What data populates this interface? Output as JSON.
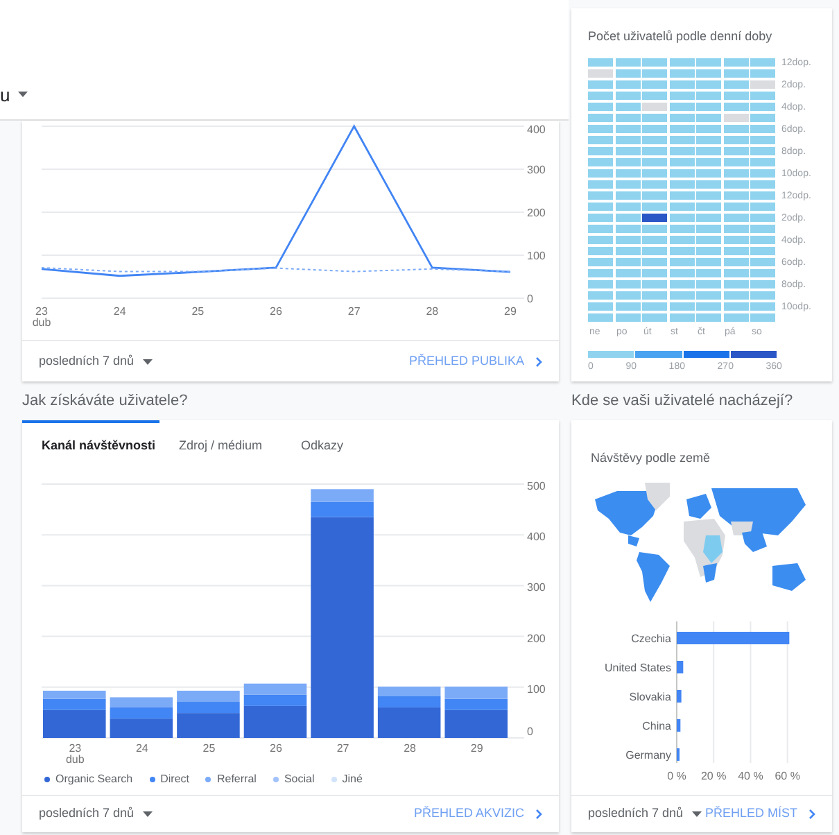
{
  "header": {
    "label": "u"
  },
  "audience_card": {
    "chart_data": {
      "type": "line",
      "grid": true,
      "categories": [
        "23",
        "24",
        "25",
        "26",
        "27",
        "28",
        "29"
      ],
      "ylim": [
        0,
        400
      ],
      "yticks": [
        0,
        100,
        200,
        300,
        400
      ],
      "series": [
        {
          "color": "#4285f4",
          "line_style": "solid",
          "values": [
            68,
            52,
            61,
            71,
            400,
            71,
            61
          ]
        },
        {
          "color": "#7baaf7",
          "line_style": "dashed",
          "values": [
            71,
            62,
            62,
            70,
            62,
            68,
            62
          ]
        }
      ]
    },
    "first_date_sublabel": "dub",
    "date_range": "posledních 7 dnů",
    "link": "PŘEHLED PUBLIKA"
  },
  "hourly_card": {
    "title": "Počet uživatelů podle denní doby",
    "rows": [
      {
        "label": "12dop.",
        "cells": [
          {
            "color": "#8fd3ef"
          },
          {
            "color": "#8fd3ef"
          },
          {
            "color": "#8fd3ef"
          },
          {
            "color": "#8fd3ef"
          },
          {
            "color": "#8fd3ef"
          },
          {
            "color": "#8fd3ef"
          },
          {
            "color": "#8fd3ef"
          }
        ]
      },
      {
        "cells": [
          {
            "color": "#dadce0"
          },
          {
            "color": "#8fd3ef"
          },
          {
            "color": "#8fd3ef"
          },
          {
            "color": "#8fd3ef"
          },
          {
            "color": "#8fd3ef"
          },
          {
            "color": "#8fd3ef"
          },
          {
            "color": "#8fd3ef"
          }
        ]
      },
      {
        "label": "2dop.",
        "cells": [
          {
            "color": "#8fd3ef"
          },
          {
            "color": "#8fd3ef"
          },
          {
            "color": "#8fd3ef"
          },
          {
            "color": "#8fd3ef"
          },
          {
            "color": "#8fd3ef"
          },
          {
            "color": "#8fd3ef"
          },
          {
            "color": "#dadce0"
          }
        ]
      },
      {
        "cells": [
          {
            "color": "#8fd3ef"
          },
          {
            "color": "#8fd3ef"
          },
          {
            "color": "#8fd3ef"
          },
          {
            "color": "#8fd3ef"
          },
          {
            "color": "#8fd3ef"
          },
          {
            "color": "#8fd3ef"
          },
          {
            "color": "#8fd3ef"
          }
        ]
      },
      {
        "label": "4dop.",
        "cells": [
          {
            "color": "#8fd3ef"
          },
          {
            "color": "#8fd3ef"
          },
          {
            "color": "#dadce0"
          },
          {
            "color": "#8fd3ef"
          },
          {
            "color": "#8fd3ef"
          },
          {
            "color": "#8fd3ef"
          },
          {
            "color": "#8fd3ef"
          }
        ]
      },
      {
        "cells": [
          {
            "color": "#8fd3ef"
          },
          {
            "color": "#8fd3ef"
          },
          {
            "color": "#8fd3ef"
          },
          {
            "color": "#8fd3ef"
          },
          {
            "color": "#8fd3ef"
          },
          {
            "color": "#dadce0"
          },
          {
            "color": "#8fd3ef"
          }
        ]
      },
      {
        "label": "6dop.",
        "cells": [
          {
            "color": "#8fd3ef"
          },
          {
            "color": "#8fd3ef"
          },
          {
            "color": "#8fd3ef"
          },
          {
            "color": "#8fd3ef"
          },
          {
            "color": "#8fd3ef"
          },
          {
            "color": "#8fd3ef"
          },
          {
            "color": "#8fd3ef"
          }
        ]
      },
      {
        "cells": [
          {
            "color": "#8fd3ef"
          },
          {
            "color": "#8fd3ef"
          },
          {
            "color": "#8fd3ef"
          },
          {
            "color": "#8fd3ef"
          },
          {
            "color": "#8fd3ef"
          },
          {
            "color": "#8fd3ef"
          },
          {
            "color": "#8fd3ef"
          }
        ]
      },
      {
        "label": "8dop.",
        "cells": [
          {
            "color": "#8fd3ef"
          },
          {
            "color": "#8fd3ef"
          },
          {
            "color": "#8fd3ef"
          },
          {
            "color": "#8fd3ef"
          },
          {
            "color": "#8fd3ef"
          },
          {
            "color": "#8fd3ef"
          },
          {
            "color": "#8fd3ef"
          }
        ]
      },
      {
        "cells": [
          {
            "color": "#8fd3ef"
          },
          {
            "color": "#8fd3ef"
          },
          {
            "color": "#8fd3ef"
          },
          {
            "color": "#8fd3ef"
          },
          {
            "color": "#8fd3ef"
          },
          {
            "color": "#8fd3ef"
          },
          {
            "color": "#8fd3ef"
          }
        ]
      },
      {
        "label": "10dop.",
        "cells": [
          {
            "color": "#8fd3ef"
          },
          {
            "color": "#8fd3ef"
          },
          {
            "color": "#8fd3ef"
          },
          {
            "color": "#8fd3ef"
          },
          {
            "color": "#8fd3ef"
          },
          {
            "color": "#8fd3ef"
          },
          {
            "color": "#8fd3ef"
          }
        ]
      },
      {
        "cells": [
          {
            "color": "#8fd3ef"
          },
          {
            "color": "#8fd3ef"
          },
          {
            "color": "#8fd3ef"
          },
          {
            "color": "#8fd3ef"
          },
          {
            "color": "#8fd3ef"
          },
          {
            "color": "#8fd3ef"
          },
          {
            "color": "#8fd3ef"
          }
        ]
      },
      {
        "label": "12odp.",
        "cells": [
          {
            "color": "#8fd3ef"
          },
          {
            "color": "#8fd3ef"
          },
          {
            "color": "#8fd3ef"
          },
          {
            "color": "#8fd3ef"
          },
          {
            "color": "#8fd3ef"
          },
          {
            "color": "#8fd3ef"
          },
          {
            "color": "#8fd3ef"
          }
        ]
      },
      {
        "cells": [
          {
            "color": "#8fd3ef"
          },
          {
            "color": "#8fd3ef"
          },
          {
            "color": "#8fd3ef"
          },
          {
            "color": "#8fd3ef"
          },
          {
            "color": "#8fd3ef"
          },
          {
            "color": "#8fd3ef"
          },
          {
            "color": "#8fd3ef"
          }
        ]
      },
      {
        "label": "2odp.",
        "cells": [
          {
            "color": "#8fd3ef"
          },
          {
            "color": "#8fd3ef"
          },
          {
            "color": "#2a56c6"
          },
          {
            "color": "#8fd3ef"
          },
          {
            "color": "#8fd3ef"
          },
          {
            "color": "#8fd3ef"
          },
          {
            "color": "#8fd3ef"
          }
        ]
      },
      {
        "cells": [
          {
            "color": "#8fd3ef"
          },
          {
            "color": "#8fd3ef"
          },
          {
            "color": "#8fd3ef"
          },
          {
            "color": "#8fd3ef"
          },
          {
            "color": "#8fd3ef"
          },
          {
            "color": "#8fd3ef"
          },
          {
            "color": "#8fd3ef"
          }
        ]
      },
      {
        "label": "4odp.",
        "cells": [
          {
            "color": "#8fd3ef"
          },
          {
            "color": "#8fd3ef"
          },
          {
            "color": "#8fd3ef"
          },
          {
            "color": "#8fd3ef"
          },
          {
            "color": "#8fd3ef"
          },
          {
            "color": "#8fd3ef"
          },
          {
            "color": "#8fd3ef"
          }
        ]
      },
      {
        "cells": [
          {
            "color": "#8fd3ef"
          },
          {
            "color": "#8fd3ef"
          },
          {
            "color": "#8fd3ef"
          },
          {
            "color": "#8fd3ef"
          },
          {
            "color": "#8fd3ef"
          },
          {
            "color": "#8fd3ef"
          },
          {
            "color": "#8fd3ef"
          }
        ]
      },
      {
        "label": "6odp.",
        "cells": [
          {
            "color": "#8fd3ef"
          },
          {
            "color": "#8fd3ef"
          },
          {
            "color": "#8fd3ef"
          },
          {
            "color": "#8fd3ef"
          },
          {
            "color": "#8fd3ef"
          },
          {
            "color": "#8fd3ef"
          },
          {
            "color": "#8fd3ef"
          }
        ]
      },
      {
        "cells": [
          {
            "color": "#8fd3ef"
          },
          {
            "color": "#8fd3ef"
          },
          {
            "color": "#8fd3ef"
          },
          {
            "color": "#8fd3ef"
          },
          {
            "color": "#8fd3ef"
          },
          {
            "color": "#8fd3ef"
          },
          {
            "color": "#8fd3ef"
          }
        ]
      },
      {
        "label": "8odp.",
        "cells": [
          {
            "color": "#8fd3ef"
          },
          {
            "color": "#8fd3ef"
          },
          {
            "color": "#8fd3ef"
          },
          {
            "color": "#8fd3ef"
          },
          {
            "color": "#8fd3ef"
          },
          {
            "color": "#8fd3ef"
          },
          {
            "color": "#8fd3ef"
          }
        ]
      },
      {
        "cells": [
          {
            "color": "#8fd3ef"
          },
          {
            "color": "#8fd3ef"
          },
          {
            "color": "#8fd3ef"
          },
          {
            "color": "#8fd3ef"
          },
          {
            "color": "#8fd3ef"
          },
          {
            "color": "#8fd3ef"
          },
          {
            "color": "#8fd3ef"
          }
        ]
      },
      {
        "label": "10odp.",
        "cells": [
          {
            "color": "#8fd3ef"
          },
          {
            "color": "#8fd3ef"
          },
          {
            "color": "#8fd3ef"
          },
          {
            "color": "#8fd3ef"
          },
          {
            "color": "#8fd3ef"
          },
          {
            "color": "#8fd3ef"
          },
          {
            "color": "#8fd3ef"
          }
        ]
      },
      {
        "cells": [
          {
            "color": "#8fd3ef"
          },
          {
            "color": "#8fd3ef"
          },
          {
            "color": "#8fd3ef"
          },
          {
            "color": "#8fd3ef"
          },
          {
            "color": "#8fd3ef"
          },
          {
            "color": "#8fd3ef"
          },
          {
            "color": "#8fd3ef"
          }
        ]
      }
    ],
    "days": [
      "ne",
      "po",
      "út",
      "st",
      "čt",
      "pá",
      "so"
    ],
    "legend": {
      "swatches": [
        {
          "color": "#8fd3ef"
        },
        {
          "color": "#4aa3f0"
        },
        {
          "color": "#1a73e8"
        },
        {
          "color": "#2a56c6"
        }
      ],
      "ticks": [
        "0",
        "90",
        "180",
        "270",
        "360"
      ]
    }
  },
  "acquisition": {
    "heading": "Jak získáváte uživatele?",
    "tabs": [
      {
        "label": "Kanál návštěvnosti",
        "selected": true
      },
      {
        "label": "Zdroj / médium",
        "selected": false
      },
      {
        "label": "Odkazy",
        "selected": false
      }
    ],
    "chart_data": {
      "type": "bar",
      "stacked": true,
      "grid": true,
      "legend": true,
      "categories": [
        "23",
        "24",
        "25",
        "26",
        "27",
        "28",
        "29"
      ],
      "ylim": [
        0,
        500
      ],
      "yticks": [
        0,
        100,
        200,
        300,
        400,
        500
      ],
      "series": [
        {
          "name": "Organic Search",
          "color": "#3367d6",
          "values": [
            55,
            38,
            49,
            63,
            435,
            60,
            55
          ]
        },
        {
          "name": "Direct",
          "color": "#4285f4",
          "values": [
            22,
            22,
            22,
            22,
            30,
            22,
            22
          ]
        },
        {
          "name": "Referral",
          "color": "#7baaf7",
          "values": [
            16,
            20,
            22,
            22,
            25,
            19,
            24
          ]
        },
        {
          "name": "Social",
          "color": "#a1c2fa",
          "values": [
            0,
            0,
            0,
            0,
            0,
            0,
            0
          ]
        },
        {
          "name": "Jiné",
          "color": "#d2e3fc",
          "values": [
            0,
            0,
            0,
            0,
            0,
            0,
            0
          ]
        }
      ]
    },
    "first_date_sublabel": "dub",
    "date_range": "posledních 7 dnů",
    "link": "PŘEHLED AKVIZIC"
  },
  "locations": {
    "heading": "Kde se vaši uživatelé nacházejí?",
    "title": "Návštěvy podle země",
    "chart_data": {
      "type": "bar",
      "orientation": "horizontal",
      "grid": true,
      "categories": [
        "Czechia",
        "United States",
        "Slovakia",
        "China",
        "Germany"
      ],
      "values": [
        61,
        3.5,
        2.5,
        2,
        1.5
      ],
      "xlim": [
        0,
        62
      ],
      "xticks": [
        {
          "value": 0,
          "label": "0 %"
        },
        {
          "value": 20,
          "label": "20 %"
        },
        {
          "value": 40,
          "label": "40 %"
        },
        {
          "value": 60,
          "label": "60 %"
        }
      ]
    },
    "date_range": "posledních 7 dnů",
    "link": "PŘEHLED MÍST"
  }
}
